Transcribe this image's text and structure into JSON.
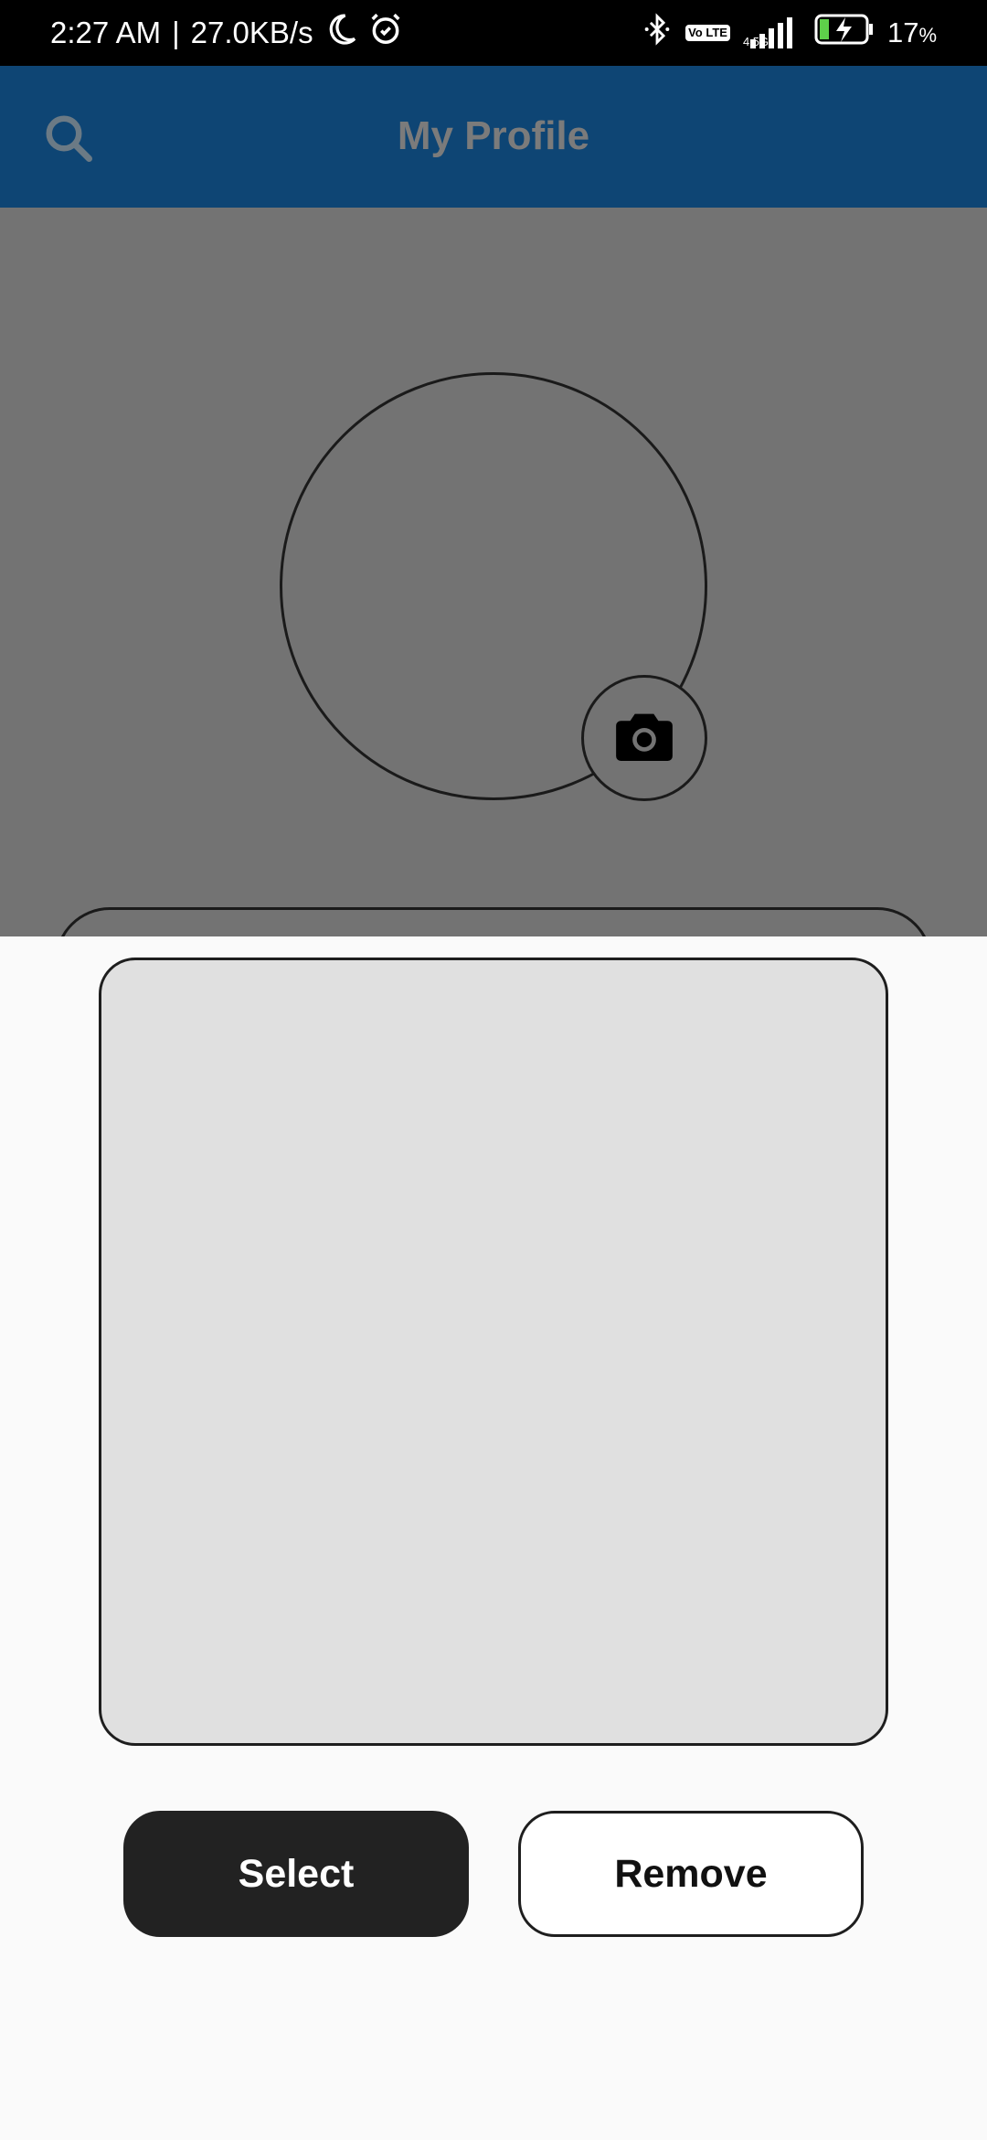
{
  "status_bar": {
    "time": "2:27 AM",
    "separator": "|",
    "speed": "27.0KB/s",
    "network": "4.5G",
    "volte": "Vo LTE",
    "battery_value": "17",
    "battery_unit": "%"
  },
  "app_bar": {
    "title": "My Profile",
    "search_icon": "search-icon",
    "color": "#0e4574"
  },
  "profile": {
    "camera_icon": "camera-icon"
  },
  "sheet": {
    "select_label": "Select",
    "remove_label": "Remove"
  }
}
